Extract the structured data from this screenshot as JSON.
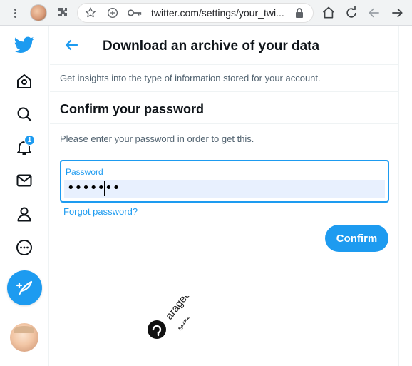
{
  "browser": {
    "url": "twitter.com/settings/your_twi...",
    "icons": [
      "more-vertical-icon",
      "profile-icon",
      "extensions-icon",
      "star-icon",
      "plus-circle-icon",
      "key-icon",
      "lock-icon",
      "home-icon",
      "reload-icon",
      "back-icon",
      "forward-icon"
    ]
  },
  "sidebar": {
    "notification_count": "1",
    "items": [
      "twitter-logo",
      "home-icon",
      "search-icon",
      "notifications-icon",
      "messages-icon",
      "profile-icon",
      "more-icon",
      "compose-icon",
      "avatar"
    ]
  },
  "page": {
    "title": "Download an archive of your data",
    "insight_text": "Get insights into the type of information stored for your account.",
    "section_title": "Confirm your password",
    "instruction": "Please enter your password in order to get this.",
    "password_label": "Password",
    "password_value": "•••••••",
    "forgot_link": "Forgot password?",
    "confirm_button": "Confirm"
  },
  "watermark": {
    "text": "arageek",
    "arabic_text": "مجتمع"
  },
  "colors": {
    "accent": "#1d9bf0",
    "text_primary": "#0f1419",
    "text_secondary": "#536471",
    "field_fill": "#e8f0fe",
    "toolbar_bg": "#f1f3f4"
  }
}
